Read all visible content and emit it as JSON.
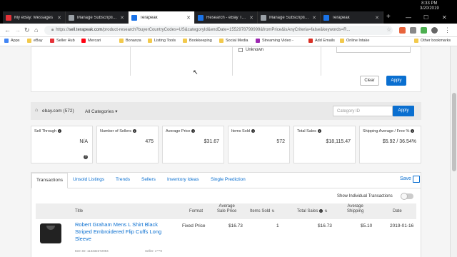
{
  "browser": {
    "tabs": [
      {
        "label": "My eBay: Messages",
        "favicon_color": "#e53238"
      },
      {
        "label": "Manage Subscriptions",
        "favicon_color": "#9aa0a6"
      },
      {
        "label": "Terapeak",
        "favicon_color": "#1a73e8"
      },
      {
        "label": "Research - eBay Top Se",
        "favicon_color": "#1a73e8"
      },
      {
        "label": "Manage Subscriptions",
        "favicon_color": "#9aa0a6"
      },
      {
        "label": "Terapeak",
        "favicon_color": "#1a73e8"
      }
    ],
    "active_tab_index": 2,
    "clock": {
      "time": "8:33 PM",
      "date": "3/20/2019"
    },
    "url_prefix": "https://",
    "url_host": "sell.terapeak.com",
    "url_rest": "/product-research?buyerCountryCodes=US&categoryId&endDate=1552978799999&fromPrice&isAnyCriteria=false&keywords=R...",
    "bookmarks": [
      {
        "label": "Apps",
        "icon": "apps-grid-icon"
      },
      {
        "label": "eBay",
        "icon": "folder-icon"
      },
      {
        "label": "Seller Hub",
        "icon": "seller-hub-icon"
      },
      {
        "label": "Mercari",
        "icon": "mercari-icon"
      },
      {
        "label": "Bonanza",
        "icon": "folder-icon"
      },
      {
        "label": "Listing Tools",
        "icon": "folder-icon"
      },
      {
        "label": "Bookkeeping",
        "icon": "folder-icon"
      },
      {
        "label": "Social Media",
        "icon": "folder-icon"
      },
      {
        "label": "Streaming Video -",
        "icon": "streaming-icon"
      },
      {
        "label": "Add Emails",
        "icon": "add-emails-icon"
      },
      {
        "label": "Online Intake",
        "icon": "folder-icon"
      },
      {
        "label": "Other bookmarks",
        "icon": "folder-icon"
      }
    ]
  },
  "filters": {
    "unknown_label": "Unknown",
    "clear_label": "Clear",
    "apply_label": "Apply"
  },
  "source": {
    "site": "ebay.com",
    "count": "(572)",
    "category": "All Categories",
    "category_id_placeholder": "Category ID",
    "apply_label": "Apply"
  },
  "stats": [
    {
      "title": "Sell Through",
      "value": "N/A"
    },
    {
      "title": "Number of Sellers",
      "value": "475"
    },
    {
      "title": "Average Price",
      "value": "$31.67"
    },
    {
      "title": "Items Sold",
      "value": "572"
    },
    {
      "title": "Total Sales",
      "value": "$18,115.47"
    },
    {
      "title": "Shipping Average / Free %",
      "value": "$5.92 / 36.54%"
    }
  ],
  "results": {
    "tabs": [
      "Transactions",
      "Unsold Listings",
      "Trends",
      "Sellers",
      "Inventory Ideas",
      "Single Prediction"
    ],
    "save_label": "Save",
    "show_individual_label": "Show Individual Transactions",
    "show_individual_on": false,
    "columns": {
      "title": "Title",
      "format": "Format",
      "avg_sale_price": "Average\nSale Price",
      "items_sold": "Items Sold",
      "total_sales": "Total Sales",
      "avg_shipping": "Average\nShipping",
      "date": "Date"
    },
    "rows": [
      {
        "title": "Robert Graham Mens L Shirt Black Striped Embroidered Flip Cuffs Long Sleeve",
        "item_id": "Item ID: 113332372994",
        "seller": "Seller: c***0",
        "format": "Fixed Price",
        "avg_sale_price": "$16.73",
        "items_sold": "1",
        "total_sales": "$16.73",
        "avg_shipping": "$5.10",
        "date": "2019-01-16"
      }
    ]
  }
}
